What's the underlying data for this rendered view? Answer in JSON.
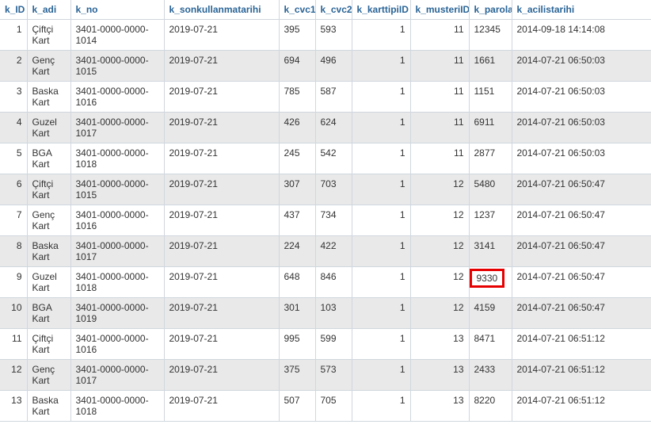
{
  "columns": [
    {
      "key": "k_ID",
      "label": "k_ID",
      "numeric": true
    },
    {
      "key": "k_adi",
      "label": "k_adi",
      "numeric": false
    },
    {
      "key": "k_no",
      "label": "k_no",
      "numeric": false
    },
    {
      "key": "k_sonkullanmatarihi",
      "label": "k_sonkullanmatarihi",
      "numeric": false
    },
    {
      "key": "k_cvc1",
      "label": "k_cvc1",
      "numeric": false
    },
    {
      "key": "k_cvc2",
      "label": "k_cvc2",
      "numeric": false
    },
    {
      "key": "k_karttipiID",
      "label": "k_karttipiID",
      "numeric": true
    },
    {
      "key": "k_musteriID",
      "label": "k_musteriID",
      "numeric": true
    },
    {
      "key": "k_parola",
      "label": "k_parola",
      "numeric": false
    },
    {
      "key": "k_acilistarihi",
      "label": "k_acilistarihi",
      "numeric": false
    }
  ],
  "highlighted": {
    "row_index": 8,
    "col_key": "k_parola"
  },
  "rows": [
    {
      "k_ID": "1",
      "k_adi": "Çiftçi Kart",
      "k_no": "3401-0000-0000-1014",
      "k_sonkullanmatarihi": "2019-07-21",
      "k_cvc1": "395",
      "k_cvc2": "593",
      "k_karttipiID": "1",
      "k_musteriID": "11",
      "k_parola": "12345",
      "k_acilistarihi": "2014-09-18 14:14:08"
    },
    {
      "k_ID": "2",
      "k_adi": "Genç Kart",
      "k_no": "3401-0000-0000-1015",
      "k_sonkullanmatarihi": "2019-07-21",
      "k_cvc1": "694",
      "k_cvc2": "496",
      "k_karttipiID": "1",
      "k_musteriID": "11",
      "k_parola": "1661",
      "k_acilistarihi": "2014-07-21 06:50:03"
    },
    {
      "k_ID": "3",
      "k_adi": "Baska Kart",
      "k_no": "3401-0000-0000-1016",
      "k_sonkullanmatarihi": "2019-07-21",
      "k_cvc1": "785",
      "k_cvc2": "587",
      "k_karttipiID": "1",
      "k_musteriID": "11",
      "k_parola": "1151",
      "k_acilistarihi": "2014-07-21 06:50:03"
    },
    {
      "k_ID": "4",
      "k_adi": "Guzel Kart",
      "k_no": "3401-0000-0000-1017",
      "k_sonkullanmatarihi": "2019-07-21",
      "k_cvc1": "426",
      "k_cvc2": "624",
      "k_karttipiID": "1",
      "k_musteriID": "11",
      "k_parola": "6911",
      "k_acilistarihi": "2014-07-21 06:50:03"
    },
    {
      "k_ID": "5",
      "k_adi": "BGA Kart",
      "k_no": "3401-0000-0000-1018",
      "k_sonkullanmatarihi": "2019-07-21",
      "k_cvc1": "245",
      "k_cvc2": "542",
      "k_karttipiID": "1",
      "k_musteriID": "11",
      "k_parola": "2877",
      "k_acilistarihi": "2014-07-21 06:50:03"
    },
    {
      "k_ID": "6",
      "k_adi": "Çiftçi Kart",
      "k_no": "3401-0000-0000-1015",
      "k_sonkullanmatarihi": "2019-07-21",
      "k_cvc1": "307",
      "k_cvc2": "703",
      "k_karttipiID": "1",
      "k_musteriID": "12",
      "k_parola": "5480",
      "k_acilistarihi": "2014-07-21 06:50:47"
    },
    {
      "k_ID": "7",
      "k_adi": "Genç Kart",
      "k_no": "3401-0000-0000-1016",
      "k_sonkullanmatarihi": "2019-07-21",
      "k_cvc1": "437",
      "k_cvc2": "734",
      "k_karttipiID": "1",
      "k_musteriID": "12",
      "k_parola": "1237",
      "k_acilistarihi": "2014-07-21 06:50:47"
    },
    {
      "k_ID": "8",
      "k_adi": "Baska Kart",
      "k_no": "3401-0000-0000-1017",
      "k_sonkullanmatarihi": "2019-07-21",
      "k_cvc1": "224",
      "k_cvc2": "422",
      "k_karttipiID": "1",
      "k_musteriID": "12",
      "k_parola": "3141",
      "k_acilistarihi": "2014-07-21 06:50:47"
    },
    {
      "k_ID": "9",
      "k_adi": "Guzel Kart",
      "k_no": "3401-0000-0000-1018",
      "k_sonkullanmatarihi": "2019-07-21",
      "k_cvc1": "648",
      "k_cvc2": "846",
      "k_karttipiID": "1",
      "k_musteriID": "12",
      "k_parola": "9330",
      "k_acilistarihi": "2014-07-21 06:50:47"
    },
    {
      "k_ID": "10",
      "k_adi": "BGA Kart",
      "k_no": "3401-0000-0000-1019",
      "k_sonkullanmatarihi": "2019-07-21",
      "k_cvc1": "301",
      "k_cvc2": "103",
      "k_karttipiID": "1",
      "k_musteriID": "12",
      "k_parola": "4159",
      "k_acilistarihi": "2014-07-21 06:50:47"
    },
    {
      "k_ID": "11",
      "k_adi": "Çiftçi Kart",
      "k_no": "3401-0000-0000-1016",
      "k_sonkullanmatarihi": "2019-07-21",
      "k_cvc1": "995",
      "k_cvc2": "599",
      "k_karttipiID": "1",
      "k_musteriID": "13",
      "k_parola": "8471",
      "k_acilistarihi": "2014-07-21 06:51:12"
    },
    {
      "k_ID": "12",
      "k_adi": "Genç Kart",
      "k_no": "3401-0000-0000-1017",
      "k_sonkullanmatarihi": "2019-07-21",
      "k_cvc1": "375",
      "k_cvc2": "573",
      "k_karttipiID": "1",
      "k_musteriID": "13",
      "k_parola": "2433",
      "k_acilistarihi": "2014-07-21 06:51:12"
    },
    {
      "k_ID": "13",
      "k_adi": "Baska Kart",
      "k_no": "3401-0000-0000-1018",
      "k_sonkullanmatarihi": "2019-07-21",
      "k_cvc1": "507",
      "k_cvc2": "705",
      "k_karttipiID": "1",
      "k_musteriID": "13",
      "k_parola": "8220",
      "k_acilistarihi": "2014-07-21 06:51:12"
    }
  ]
}
